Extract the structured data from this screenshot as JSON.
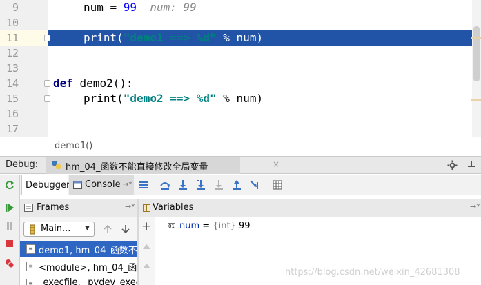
{
  "editor": {
    "lines": [
      {
        "no": "9",
        "tokens": [
          {
            "t": "num = ",
            "c": ""
          },
          {
            "t": "99",
            "c": "num"
          },
          {
            "t": "  num: 99",
            "c": "hint"
          }
        ],
        "indent": true
      },
      {
        "no": "10",
        "tokens": [],
        "indent": true
      },
      {
        "no": "11",
        "tokens": [
          {
            "t": "print(",
            "c": ""
          },
          {
            "t": "\"demo1 ==> %d\"",
            "c": "str"
          },
          {
            "t": " % num)",
            "c": ""
          }
        ],
        "indent": true,
        "highlight": true
      },
      {
        "no": "12",
        "tokens": [],
        "indent": true
      },
      {
        "no": "13",
        "tokens": [],
        "indent": true
      },
      {
        "no": "14",
        "tokens": [
          {
            "t": "def",
            "c": "kw"
          },
          {
            "t": " demo2():",
            "c": ""
          }
        ],
        "indent": false
      },
      {
        "no": "15",
        "tokens": [
          {
            "t": "print(",
            "c": ""
          },
          {
            "t": "\"demo2 ==> %d\"",
            "c": "str"
          },
          {
            "t": " % num)",
            "c": ""
          }
        ],
        "indent": true
      },
      {
        "no": "16",
        "tokens": [],
        "indent": true
      },
      {
        "no": "17",
        "tokens": [],
        "indent": true
      }
    ],
    "breadcrumb": "demo1()"
  },
  "debug": {
    "label": "Debug:",
    "session_tab": "hm_04_函数不能直接修改全局变量",
    "close_glyph": "×",
    "tabs": {
      "debugger": "Debugger",
      "console": "Console",
      "console_pin": "→*"
    },
    "frames": {
      "header": "Frames",
      "pin": "→*",
      "thread": "Main...",
      "rows": [
        {
          "text": "demo1, hm_04_函数不",
          "selected": true
        },
        {
          "text": "<module>, hm_04_函",
          "selected": false
        },
        {
          "text": "_execfile, _pydev_exec",
          "selected": false
        }
      ]
    },
    "variables": {
      "header": "Variables",
      "pin": "→*",
      "add": "+",
      "items": [
        {
          "name": "num",
          "eq": " = ",
          "type": "{int}",
          "value": " 99"
        }
      ]
    },
    "watermark": "https://blog.csdn.net/weixin_42681308"
  },
  "colors": {
    "selection": "#2154a6",
    "accent": "#2e66c4",
    "string": "#008080",
    "keyword": "#000080"
  }
}
